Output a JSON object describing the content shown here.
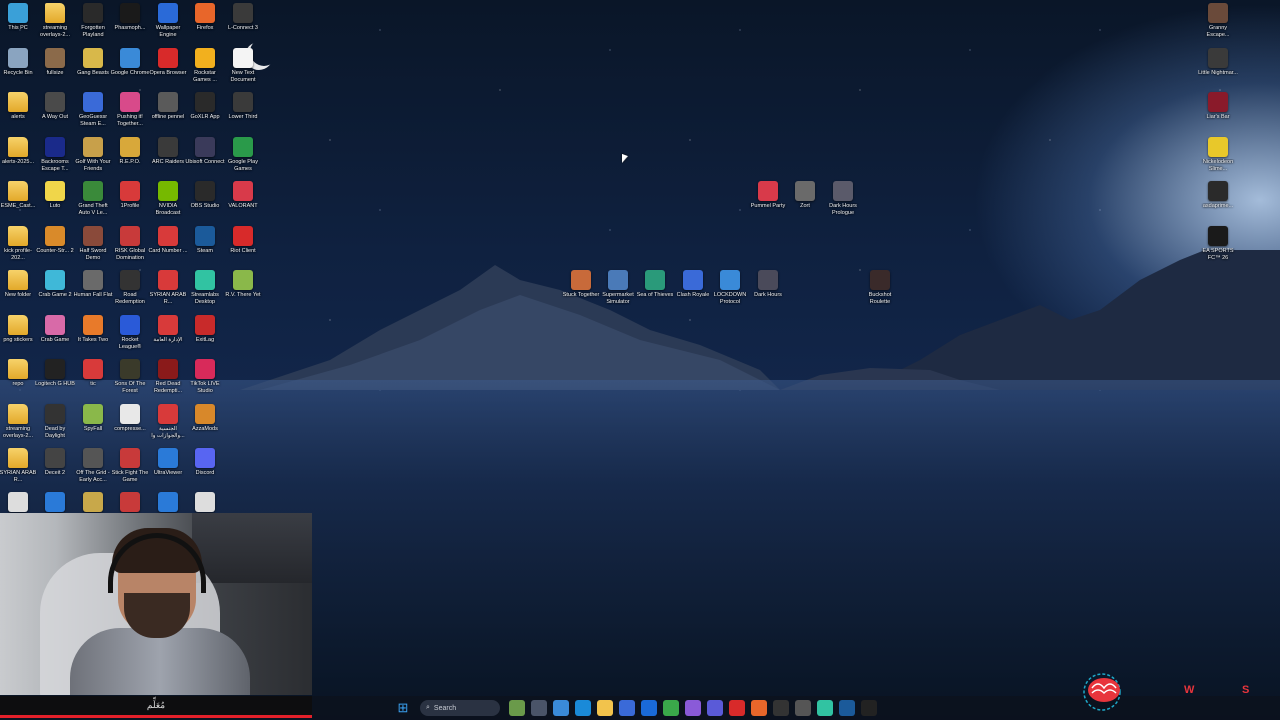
{
  "desktop": {
    "col1": [
      {
        "label": "This PC",
        "icon": "computer-icon",
        "color": "#3aa0d8"
      },
      {
        "label": "Recycle Bin",
        "icon": "recycle-bin-icon",
        "color": "#8aa4c0"
      },
      {
        "label": "alerts",
        "icon": "folder-icon",
        "color": "#f2c34c"
      },
      {
        "label": "alerts-2025...",
        "icon": "folder-icon",
        "color": "#f2c34c"
      },
      {
        "label": "ESME_Cast...",
        "icon": "folder-icon",
        "color": "#f2c34c"
      },
      {
        "label": "kick profile-202...",
        "icon": "folder-icon",
        "color": "#f2c34c"
      },
      {
        "label": "New folder",
        "icon": "folder-icon",
        "color": "#f2c34c"
      },
      {
        "label": "png stickers",
        "icon": "folder-icon",
        "color": "#f2c34c"
      },
      {
        "label": "repo",
        "icon": "folder-icon",
        "color": "#f2c34c"
      },
      {
        "label": "streaming overlays-2...",
        "icon": "folder-icon",
        "color": "#f2c34c"
      },
      {
        "label": "SYRIAN ARAB R...",
        "icon": "folder-icon",
        "color": "#f2c34c"
      }
    ],
    "col2": [
      {
        "label": "streaming overlays-2...",
        "icon": "folder-icon",
        "color": "#f2c34c"
      },
      {
        "label": "fullsize",
        "icon": "image-file-icon",
        "color": "#8b6a4a"
      },
      {
        "label": "A Way Out",
        "icon": "game-icon",
        "color": "#4a4a4a"
      },
      {
        "label": "Backrooms Escape T...",
        "icon": "game-icon",
        "color": "#1a2a8a"
      },
      {
        "label": "Luto",
        "icon": "game-icon",
        "color": "#f0d64a"
      },
      {
        "label": "Counter-Str... 2",
        "icon": "game-icon",
        "color": "#d98a2a"
      },
      {
        "label": "Crab Game 2",
        "icon": "game-icon",
        "color": "#3fb8d8"
      },
      {
        "label": "Crab Game",
        "icon": "game-icon",
        "color": "#d86aa8"
      },
      {
        "label": "Logitech G HUB",
        "icon": "app-icon",
        "color": "#222222"
      },
      {
        "label": "Dead by Daylight",
        "icon": "game-icon",
        "color": "#333333"
      },
      {
        "label": "Deceit 2",
        "icon": "game-icon",
        "color": "#444444"
      }
    ],
    "col3": [
      {
        "label": "Forgotten Playland",
        "icon": "game-icon",
        "color": "#2a2a2a"
      },
      {
        "label": "Gang Beasts",
        "icon": "game-icon",
        "color": "#d8b84a"
      },
      {
        "label": "GeoGuessr Steam E...",
        "icon": "game-icon",
        "color": "#3a6ad8"
      },
      {
        "label": "Golf With Your Friends",
        "icon": "game-icon",
        "color": "#c8a04a"
      },
      {
        "label": "Grand Theft Auto V Le...",
        "icon": "game-icon",
        "color": "#3a8a3a"
      },
      {
        "label": "Half Sword Demo",
        "icon": "game-icon",
        "color": "#8a4a3a"
      },
      {
        "label": "Human Fall Flat",
        "icon": "game-icon",
        "color": "#6a6a6a"
      },
      {
        "label": "It Takes Two",
        "icon": "game-icon",
        "color": "#e87a2a"
      },
      {
        "label": "tic",
        "icon": "pdf-icon",
        "color": "#d83a3a"
      },
      {
        "label": "SpyFall",
        "icon": "game-icon",
        "color": "#8ab84a"
      },
      {
        "label": "Off The Grid - Early Acc...",
        "icon": "game-icon",
        "color": "#555555"
      }
    ],
    "col4": [
      {
        "label": "Phasmoph...",
        "icon": "game-icon",
        "color": "#1a1a1a"
      },
      {
        "label": "Google Chrome",
        "icon": "chrome-icon",
        "color": "#3a8ad8"
      },
      {
        "label": "Pushing it! Together...",
        "icon": "game-icon",
        "color": "#d84a8a"
      },
      {
        "label": "R.E.P.O.",
        "icon": "game-icon",
        "color": "#d8a83a"
      },
      {
        "label": "1Profile",
        "icon": "pdf-icon",
        "color": "#d83a3a"
      },
      {
        "label": "RISK Global Domination",
        "icon": "game-icon",
        "color": "#c83a3a"
      },
      {
        "label": "Road Redemption",
        "icon": "game-icon",
        "color": "#333333"
      },
      {
        "label": "Rocket League®",
        "icon": "game-icon",
        "color": "#2a5ad8"
      },
      {
        "label": "Sons Of The Forest",
        "icon": "game-icon",
        "color": "#3a3a2a"
      },
      {
        "label": "compresse...",
        "icon": "file-icon",
        "color": "#e8e8e8"
      },
      {
        "label": "Stick Fight The Game",
        "icon": "game-icon",
        "color": "#c83a3a"
      }
    ],
    "col5": [
      {
        "label": "Wallpaper Engine",
        "icon": "app-icon",
        "color": "#2a6ad8"
      },
      {
        "label": "Opera Browser",
        "icon": "opera-icon",
        "color": "#d82a2a"
      },
      {
        "label": "offline pennel",
        "icon": "game-icon",
        "color": "#5a5a5a"
      },
      {
        "label": "ARC Raiders",
        "icon": "game-icon",
        "color": "#3a3a3a"
      },
      {
        "label": "NVIDIA Broadcast",
        "icon": "nvidia-icon",
        "color": "#76b900"
      },
      {
        "label": "Card Number ...",
        "icon": "pdf-icon",
        "color": "#d83a3a"
      },
      {
        "label": "SYRIAN ARAB R...",
        "icon": "pdf-icon",
        "color": "#d83a3a"
      },
      {
        "label": "الإدارة العامة",
        "icon": "pdf-icon",
        "color": "#d83a3a"
      },
      {
        "label": "Red Dead Redempti...",
        "icon": "game-icon",
        "color": "#8a1a1a"
      },
      {
        "label": "الجنسية والجوازات وا...",
        "icon": "pdf-icon",
        "color": "#d83a3a"
      },
      {
        "label": "UltraViewer",
        "icon": "app-icon",
        "color": "#2a7ad8"
      }
    ],
    "col6": [
      {
        "label": "Firefox",
        "icon": "firefox-icon",
        "color": "#e8662a"
      },
      {
        "label": "Rockstar Games ...",
        "icon": "rockstar-icon",
        "color": "#f2b01e"
      },
      {
        "label": "GoXLR App",
        "icon": "app-icon",
        "color": "#2a2a2a"
      },
      {
        "label": "Ubisoft Connect",
        "icon": "ubisoft-icon",
        "color": "#3a3a5a"
      },
      {
        "label": "OBS Studio",
        "icon": "obs-icon",
        "color": "#2a2a2a"
      },
      {
        "label": "Steam",
        "icon": "steam-icon",
        "color": "#1b5a9a"
      },
      {
        "label": "Streamlabs Desktop",
        "icon": "app-icon",
        "color": "#31c3a2"
      },
      {
        "label": "ExitLag",
        "icon": "app-icon",
        "color": "#c82a2a"
      },
      {
        "label": "TikTok LIVE Studio",
        "icon": "tiktok-icon",
        "color": "#d82a5a"
      },
      {
        "label": "AzzaMods",
        "icon": "app-icon",
        "color": "#d8882a"
      },
      {
        "label": "Discord",
        "icon": "discord-icon",
        "color": "#5865f2"
      }
    ],
    "col7": [
      {
        "label": "L-Connect 3",
        "icon": "app-icon",
        "color": "#3a3a3a"
      },
      {
        "label": "New Text Document",
        "icon": "text-file-icon",
        "color": "#f4f4f4"
      },
      {
        "label": "Lower Third",
        "icon": "app-icon",
        "color": "#3a3a3a"
      },
      {
        "label": "Google Play Games",
        "icon": "play-games-icon",
        "color": "#2a9a4a"
      },
      {
        "label": "VALORANT",
        "icon": "valorant-icon",
        "color": "#d83a4a"
      },
      {
        "label": "Riot Client",
        "icon": "riot-icon",
        "color": "#d82a2a"
      },
      {
        "label": "R.V. There Yet",
        "icon": "game-icon",
        "color": "#8ab84a"
      }
    ],
    "row_bottom": [
      {
        "icon": "app-icon",
        "color": "#ddd"
      },
      {
        "icon": "app-icon",
        "color": "#2a7ad8"
      },
      {
        "icon": "game-icon",
        "color": "#c8a84a"
      },
      {
        "icon": "game-icon",
        "color": "#c83a3a"
      },
      {
        "icon": "app-icon",
        "color": "#2a7ad8"
      },
      {
        "icon": "app-icon",
        "color": "#ddd"
      }
    ],
    "mid_top": [
      {
        "label": "Pummel Party",
        "icon": "game-icon",
        "color": "#d83a4a"
      },
      {
        "label": "Zort",
        "icon": "game-icon",
        "color": "#6a6a6a"
      },
      {
        "label": "Dark Hours Prologue",
        "icon": "game-icon",
        "color": "#5a5a6a"
      }
    ],
    "mid_row": [
      {
        "label": "Stuck Together",
        "icon": "game-icon",
        "color": "#c86a3a"
      },
      {
        "label": "Supermarket Simulator",
        "icon": "game-icon",
        "color": "#4a7ab8"
      },
      {
        "label": "Sea of Thieves",
        "icon": "game-icon",
        "color": "#2a9a7a"
      },
      {
        "label": "Clash Royale",
        "icon": "game-icon",
        "color": "#3a6ad8"
      },
      {
        "label": "LOCKDOWN Protocol",
        "icon": "game-icon",
        "color": "#3a8ad8"
      },
      {
        "label": "Dark Hours",
        "icon": "game-icon",
        "color": "#4a4a5a"
      }
    ],
    "mid_single": {
      "label": "Buckshot Roulette",
      "icon": "game-icon",
      "color": "#3a2a2a"
    },
    "right_col": [
      {
        "label": "Granny Escape...",
        "icon": "game-icon",
        "color": "#6a4a3a"
      },
      {
        "label": "Little Nightmar...",
        "icon": "game-icon",
        "color": "#3a3a3a"
      },
      {
        "label": "Liar's Bar",
        "icon": "game-icon",
        "color": "#8a1a2a"
      },
      {
        "label": "Nickelodeon Slime...",
        "icon": "game-icon",
        "color": "#e8c82a"
      },
      {
        "label": "asdaprime...",
        "icon": "game-icon",
        "color": "#2a2a2a"
      },
      {
        "label": "EA SPORTS FC™ 26",
        "icon": "game-icon",
        "color": "#1a1a1a"
      }
    ]
  },
  "webcam": {
    "caption": "مُعَلِّم"
  },
  "taskbar": {
    "search_placeholder": "Search",
    "items": [
      {
        "icon": "weather-icon",
        "color": "#6a9a4a"
      },
      {
        "icon": "task-view-icon",
        "color": "#4a5468"
      },
      {
        "icon": "copilot-icon",
        "color": "#3a8ad8"
      },
      {
        "icon": "edge-icon",
        "color": "#1a8ad8"
      },
      {
        "icon": "file-explorer-icon",
        "color": "#f2c34c"
      },
      {
        "icon": "store-icon",
        "color": "#3a6ad8"
      },
      {
        "icon": "outlook-icon",
        "color": "#1a6ad8"
      },
      {
        "icon": "chrome-icon",
        "color": "#3aa84a"
      },
      {
        "icon": "spotify-like-icon",
        "color": "#8a5ad8"
      },
      {
        "icon": "teams-icon",
        "color": "#5a5ad8"
      },
      {
        "icon": "opera-icon",
        "color": "#d82a2a"
      },
      {
        "icon": "firefox-icon",
        "color": "#e8662a"
      },
      {
        "icon": "goxlr-icon",
        "color": "#333"
      },
      {
        "icon": "settings-icon",
        "color": "#555"
      },
      {
        "icon": "streamlabs-icon",
        "color": "#31c3a2"
      },
      {
        "icon": "steam-icon",
        "color": "#1b5a9a"
      },
      {
        "icon": "kick-icon",
        "color": "#222"
      }
    ]
  },
  "overlay": {
    "left_letter": "W",
    "right_letter": "S"
  }
}
